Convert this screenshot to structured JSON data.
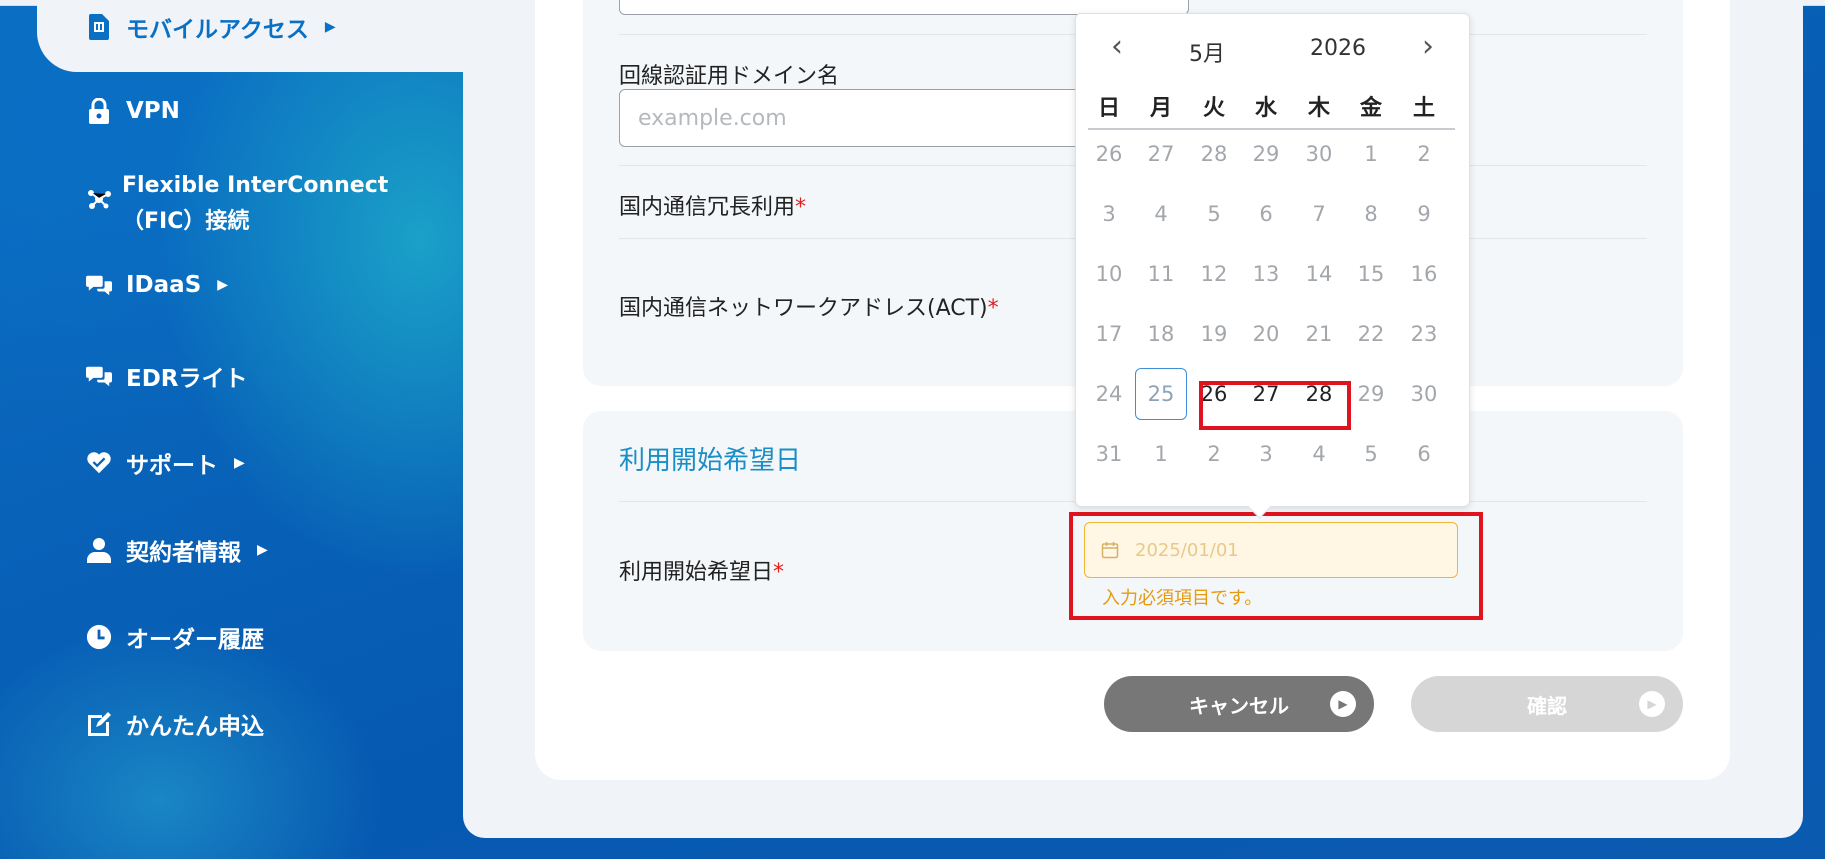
{
  "sidebar": {
    "items": [
      {
        "label": "モバイルアクセス",
        "icon": "sim-card-icon",
        "arrow": "▶",
        "active": true
      },
      {
        "label": "VPN",
        "icon": "lock-icon"
      },
      {
        "label": "Flexible InterConnect",
        "label2": "（FIC）接続",
        "icon": "network-icon"
      },
      {
        "label": "IDaaS",
        "icon": "chat-icon",
        "arrow": "▶"
      },
      {
        "label": "EDRライト",
        "icon": "chat-icon"
      },
      {
        "label": "サポート",
        "icon": "support-heart-icon",
        "arrow": "▶"
      },
      {
        "label": "契約者情報",
        "icon": "user-icon",
        "arrow": "▶"
      },
      {
        "label": "オーダー履歴",
        "icon": "clock-icon"
      },
      {
        "label": "かんたん申込",
        "icon": "edit-icon"
      }
    ]
  },
  "form": {
    "domain_label": "回線認証用ドメイン名",
    "domain_placeholder": "example.com",
    "redundancy_label": "国内通信冗長利用",
    "network_label": "国内通信ネットワークアドレス(ACT)",
    "required_mark": "*",
    "start_section_title": "利用開始希望日",
    "start_label": "利用開始希望日",
    "start_placeholder": "2025/01/01",
    "start_error": "入力必須項目です。"
  },
  "buttons": {
    "cancel": "キャンセル",
    "confirm": "確認"
  },
  "datepicker": {
    "month": "5月",
    "year": "2026",
    "prev": "‹",
    "next": "›",
    "weekdays": [
      "日",
      "月",
      "火",
      "水",
      "木",
      "金",
      "土"
    ],
    "weeks": [
      [
        "26",
        "27",
        "28",
        "29",
        "30",
        "1",
        "2"
      ],
      [
        "3",
        "4",
        "5",
        "6",
        "7",
        "8",
        "9"
      ],
      [
        "10",
        "11",
        "12",
        "13",
        "14",
        "15",
        "16"
      ],
      [
        "17",
        "18",
        "19",
        "20",
        "21",
        "22",
        "23"
      ],
      [
        "24",
        "25",
        "26",
        "27",
        "28",
        "29",
        "30"
      ],
      [
        "31",
        "1",
        "2",
        "3",
        "4",
        "5",
        "6"
      ]
    ],
    "today": "25",
    "enabled_days": [
      "26",
      "27",
      "28"
    ]
  },
  "colors": {
    "accent": "#1a8ec8",
    "required": "#e02020",
    "error": "#e59a10",
    "highlight_box": "#e0141e"
  }
}
